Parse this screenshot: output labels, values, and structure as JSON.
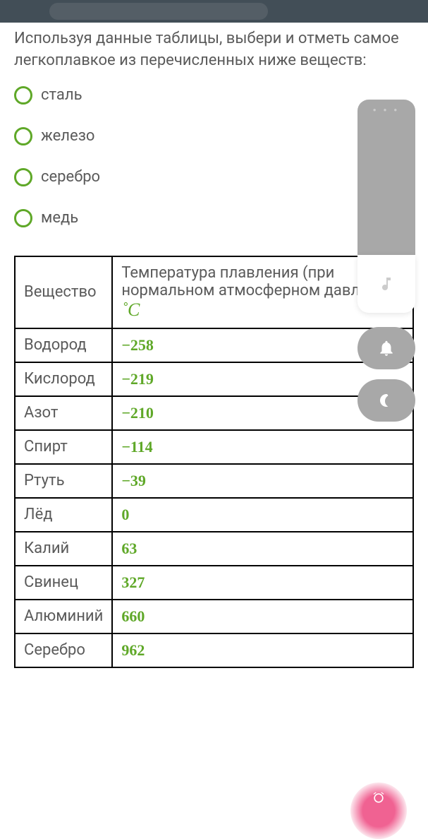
{
  "question": "Используя данные таблицы, выбери и отметь самое легкоплавкое из перечисленных ниже веществ:",
  "options": [
    {
      "label": "сталь"
    },
    {
      "label": "железо"
    },
    {
      "label": "серебро"
    },
    {
      "label": "медь"
    }
  ],
  "table": {
    "header_substance": "Вещество",
    "header_temp": "Температура плавления (при нормальном атмосферном давлении), ",
    "header_unit": "˚C",
    "rows": [
      {
        "substance": "Водород",
        "value": "−258"
      },
      {
        "substance": "Кислород",
        "value": "−219"
      },
      {
        "substance": "Азот",
        "value": "−210"
      },
      {
        "substance": "Спирт",
        "value": "−114"
      },
      {
        "substance": "Ртуть",
        "value": "−39"
      },
      {
        "substance": "Лёд",
        "value": "0"
      },
      {
        "substance": "Калий",
        "value": "63"
      },
      {
        "substance": "Свинец",
        "value": "327"
      },
      {
        "substance": "Алюминий",
        "value": "660"
      },
      {
        "substance": "Серебро",
        "value": "962"
      }
    ]
  }
}
